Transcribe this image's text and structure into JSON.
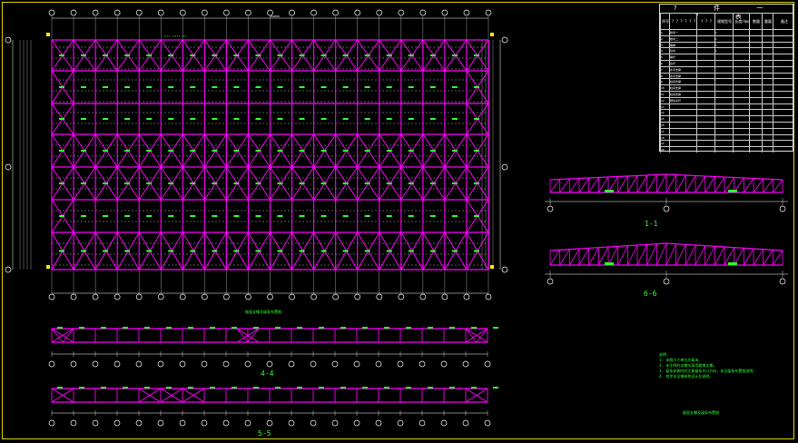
{
  "drawing_title": "屋面支撑及檩条布置图",
  "plan": {
    "top_dimension": "162000",
    "title_label": "???? ????? ???"
  },
  "materials_table": {
    "title": "? 件 一 ? 表",
    "headers": [
      "序号",
      "? ? ? ? ? ?",
      "? ? ?",
      "规格型号",
      "长度/mm",
      "数量",
      "重量",
      "备注"
    ],
    "rows": [
      [
        "1",
        "檩条一",
        "",
        "C",
        ""
      ],
      [
        "2",
        "檩条二",
        "",
        "C",
        ""
      ],
      [
        "3",
        "隅撑",
        "",
        "L",
        ""
      ],
      [
        "4",
        "拉条",
        "",
        "L",
        ""
      ],
      [
        "5",
        "撑杆",
        "",
        "",
        ""
      ],
      [
        "6",
        "系杆",
        "",
        "",
        ""
      ],
      [
        "7",
        "水平支撑",
        "",
        "",
        ""
      ],
      [
        "8",
        "水平支撑",
        "",
        "",
        ""
      ],
      [
        "9",
        "柱间支撑",
        "",
        "",
        ""
      ],
      [
        "10",
        "柱间支撑",
        "",
        "",
        ""
      ],
      [
        "11",
        "柱间支撑",
        "",
        "",
        ""
      ],
      [
        "12",
        "刚性系杆",
        "",
        "",
        ""
      ],
      [
        "13",
        "",
        "",
        "",
        ""
      ],
      [
        "14",
        "",
        "",
        "",
        ""
      ],
      [
        "15",
        "",
        "",
        "",
        ""
      ],
      [
        "16",
        "",
        "",
        "",
        ""
      ],
      [
        "17",
        "",
        "",
        "",
        ""
      ],
      [
        "18",
        "",
        "",
        "",
        ""
      ],
      [
        "19",
        "",
        "",
        "",
        ""
      ],
      [
        "20",
        "",
        "",
        "",
        ""
      ]
    ]
  },
  "sections": {
    "s11": "1-1",
    "s66": "6-6",
    "s44": "4-4",
    "s55": "5-5"
  },
  "notes": {
    "heading": "说明:",
    "lines": [
      "1. 本图尺寸单位为毫米。",
      "2. 未注明的支撑均采用圆钢支撑。",
      "3. 檩条安装时应注意檩条开口方向，详见檩条布置图说明。",
      "4. 其余详见钢结构设计总说明。"
    ]
  },
  "colors": {
    "member": "#ff00ff",
    "label": "#33ff33",
    "grid": "#ffffff",
    "border": "#e0d000"
  }
}
